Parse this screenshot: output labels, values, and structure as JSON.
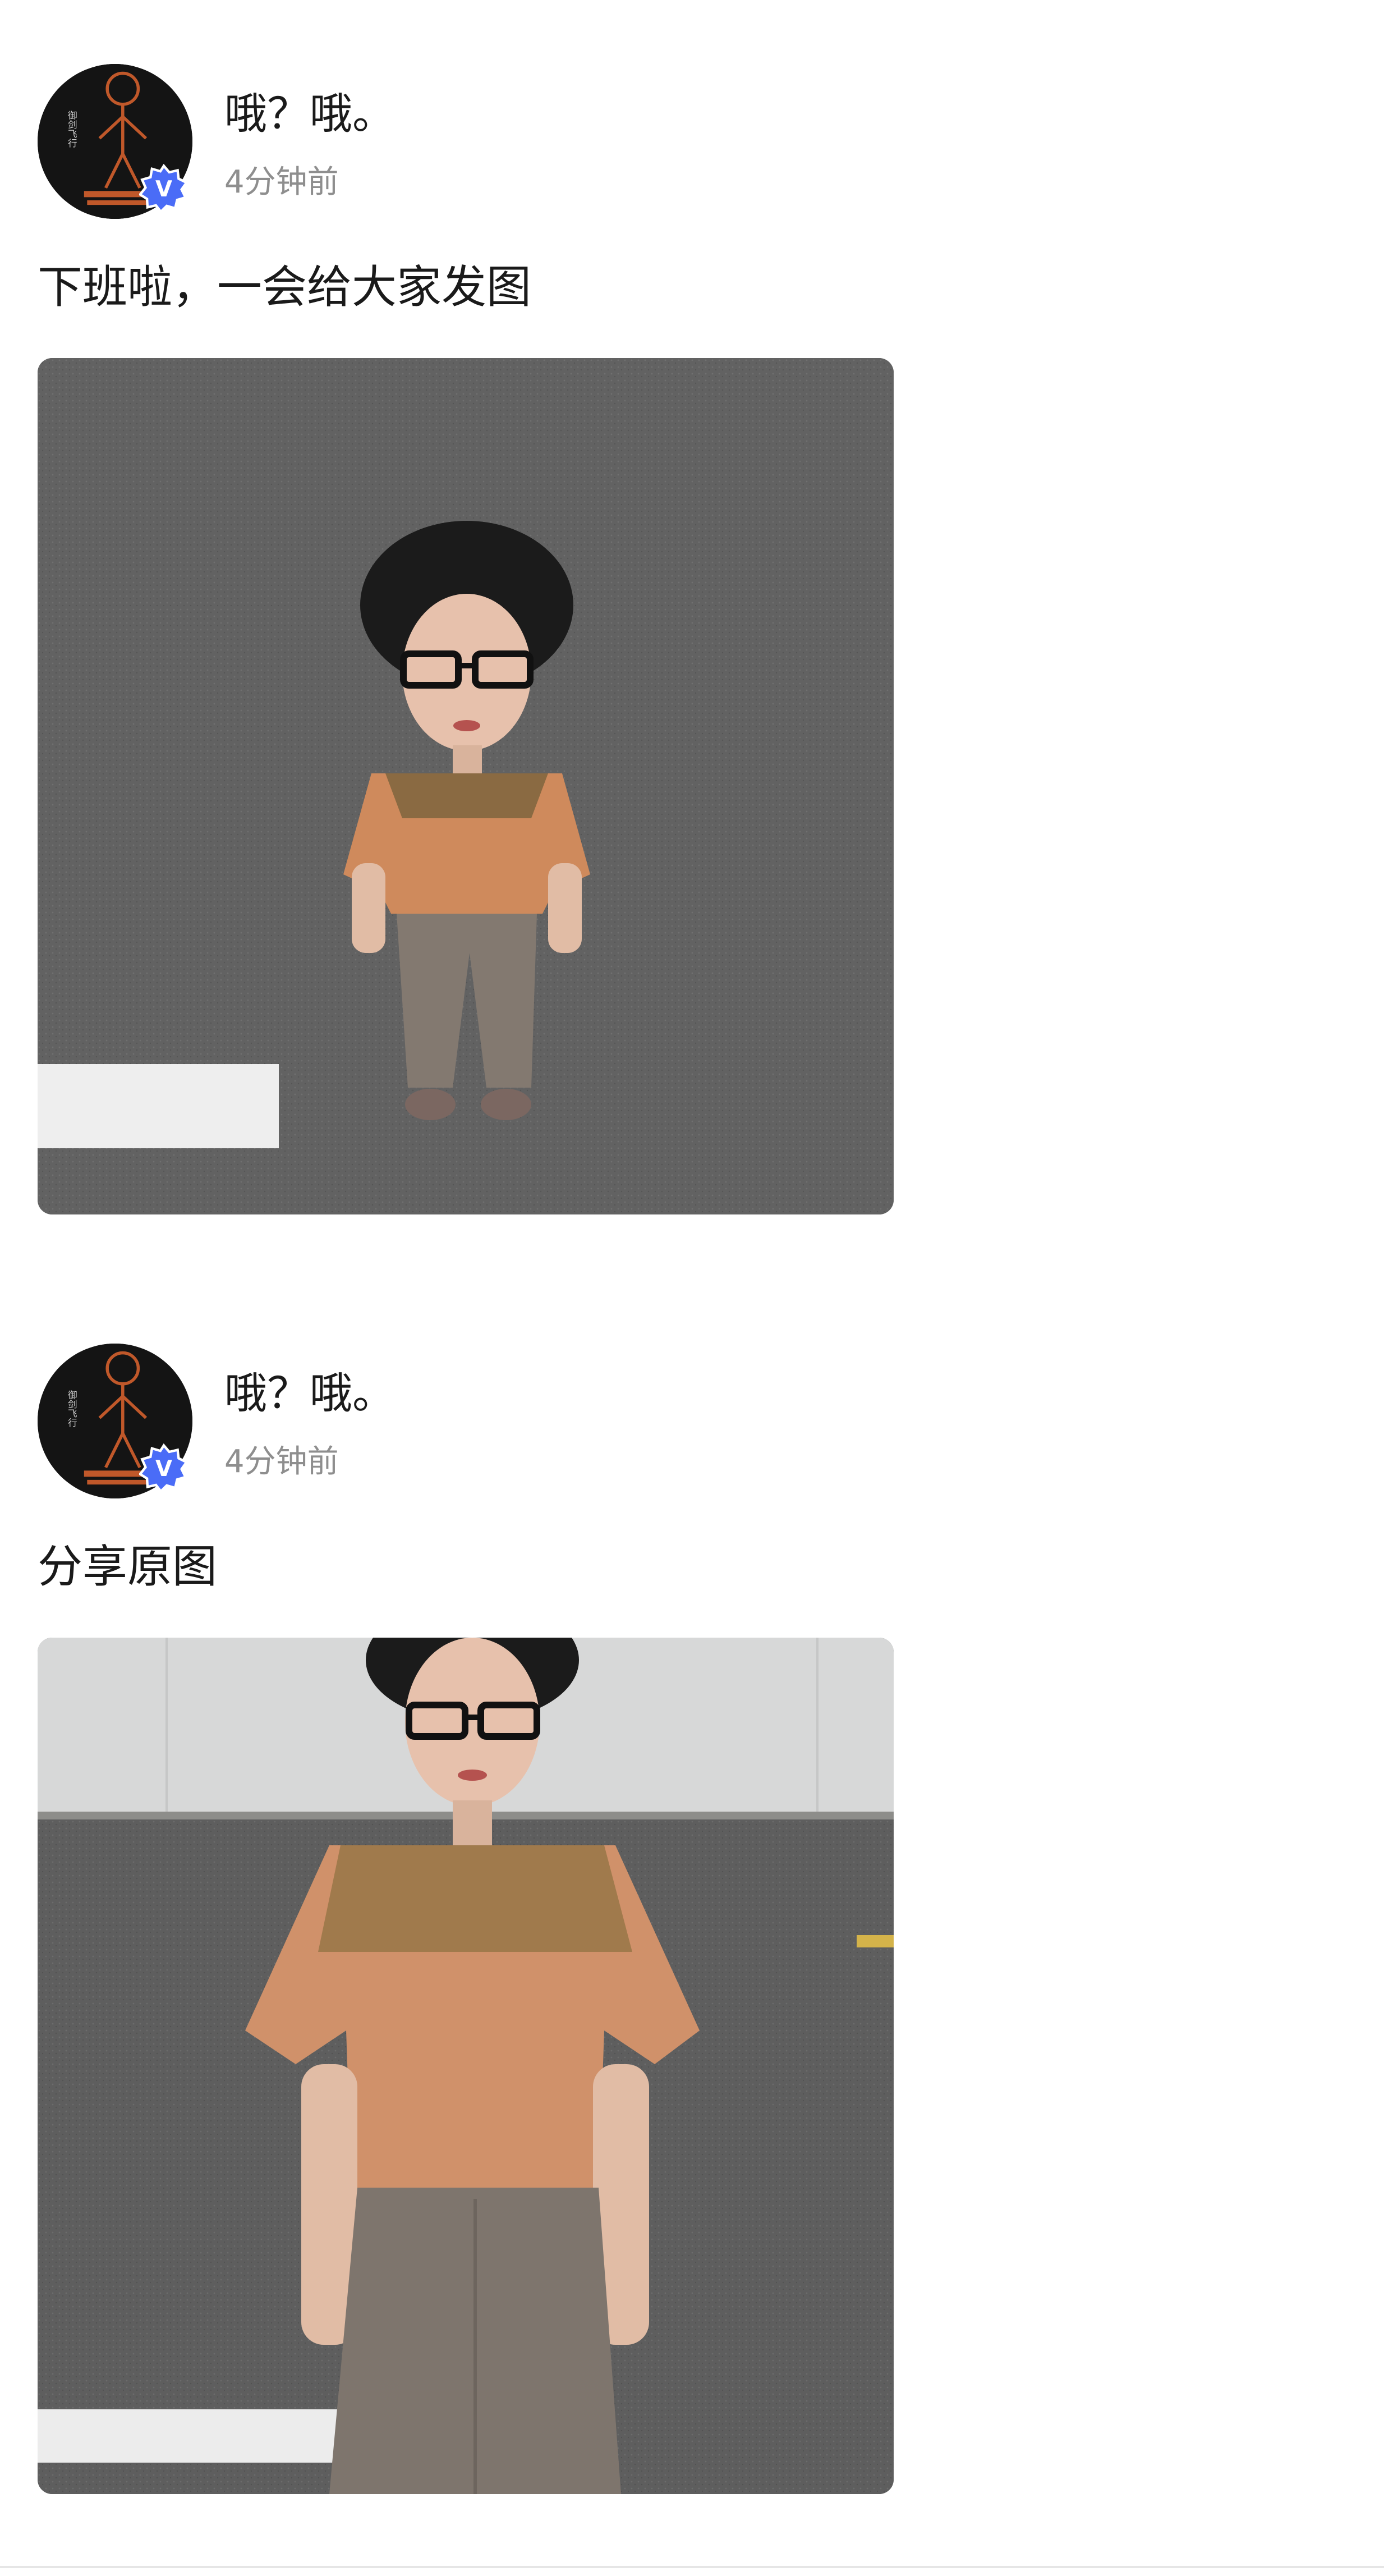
{
  "posts": [
    {
      "username": "哦？哦。",
      "time": "4分钟前",
      "caption": "下班啦，一会给大家发图",
      "avatar_text": "御剑飞行",
      "verified_mark": "V"
    },
    {
      "username": "哦？哦。",
      "time": "4分钟前",
      "caption": "分享原图",
      "avatar_text": "御剑飞行",
      "verified_mark": "V"
    }
  ],
  "colors": {
    "verified_badge": "#4a6cf7",
    "avatar_bg": "#141414",
    "avatar_figure": "#c0582a",
    "timestamp": "#8e8e8e",
    "text": "#1a1a1a"
  },
  "icons": [
    "verified-badge-icon",
    "avatar-stick-figure"
  ]
}
